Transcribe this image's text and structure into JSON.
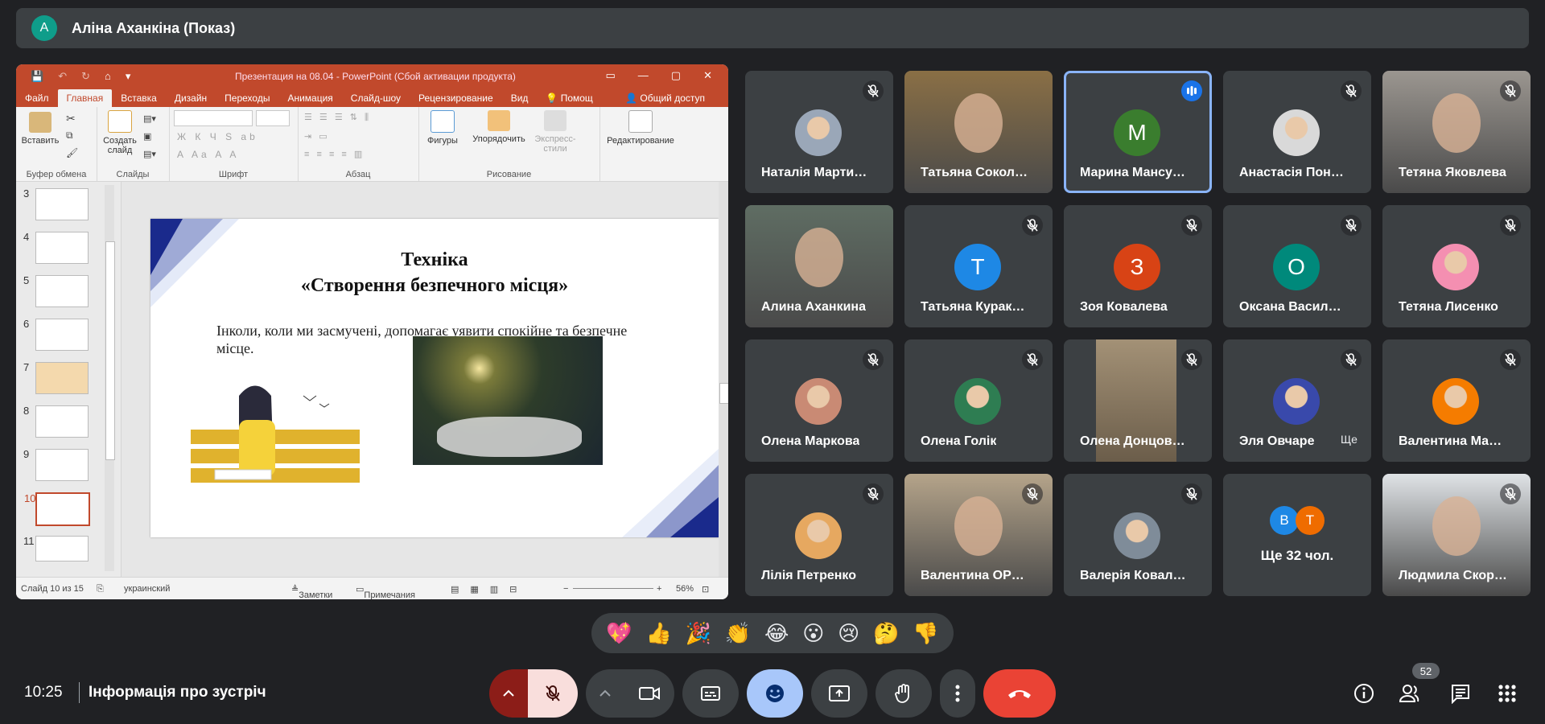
{
  "presenter": {
    "avatar_letter": "A",
    "label": "Аліна Аханкіна (Показ)"
  },
  "ppt": {
    "window_title": "Презентация на 08.04 - PowerPoint (Сбой активации продукта)",
    "menu": [
      "Файл",
      "Главная",
      "Вставка",
      "Дизайн",
      "Переходы",
      "Анимация",
      "Слайд-шоу",
      "Рецензирование",
      "Вид",
      "Помощ"
    ],
    "share": "Общий доступ",
    "ribbon": {
      "paste": "Вставить",
      "new_slide": "Создать слайд",
      "group_clipboard": "Буфер обмена",
      "group_slides": "Слайды",
      "group_font": "Шрифт",
      "group_paragraph": "Абзац",
      "group_drawing": "Рисование",
      "shapes": "Фигуры",
      "arrange": "Упорядочить",
      "express_styles": "Экспресс-стили",
      "editing": "Редактирование"
    },
    "thumb_numbers": [
      "3",
      "4",
      "5",
      "6",
      "7",
      "8",
      "9",
      "10",
      "11"
    ],
    "slide": {
      "title_line1": "Техніка",
      "title_line2": "«Створення безпечного місця»",
      "body": "Інколи, коли ми засмучені, допомагає уявити спокійне та безпечне місце."
    },
    "status": {
      "slide_of": "Слайд 10 из 15",
      "lang": "украинский",
      "notes": "Заметки",
      "comments": "Примечания",
      "zoom": "56%"
    }
  },
  "participants": [
    {
      "name": "Наталія Марти…",
      "muted": true,
      "kind": "small-photo",
      "color": "#9aa7b8"
    },
    {
      "name": "Татьяна Сокол…",
      "muted": false,
      "kind": "video",
      "color": "#8a6f45"
    },
    {
      "name": "Марина Мансу…",
      "muted": false,
      "kind": "letter",
      "letter": "M",
      "color": "#3a7d2e",
      "speaking": true
    },
    {
      "name": "Анастасія Пон…",
      "muted": true,
      "kind": "small-photo",
      "color": "#d9d9d9"
    },
    {
      "name": "Тетяна Яковлева",
      "muted": true,
      "kind": "video",
      "color": "#9b9690"
    },
    {
      "name": "Алина Аханкина",
      "muted": false,
      "kind": "video",
      "color": "#5f6d63"
    },
    {
      "name": "Татьяна Курак…",
      "muted": true,
      "kind": "letter",
      "letter": "T",
      "color": "#1e88e5"
    },
    {
      "name": "Зоя Ковалева",
      "muted": true,
      "kind": "letter",
      "letter": "З",
      "color": "#d84315"
    },
    {
      "name": "Оксана Васил…",
      "muted": true,
      "kind": "letter",
      "letter": "O",
      "color": "#00897b"
    },
    {
      "name": "Тетяна Лисенко",
      "muted": true,
      "kind": "small-photo",
      "color": "#f48fb1"
    },
    {
      "name": "Олена Маркова",
      "muted": true,
      "kind": "small-photo",
      "color": "#c98a74"
    },
    {
      "name": "Олена Голік",
      "muted": true,
      "kind": "small-photo",
      "color": "#2e7d52"
    },
    {
      "name": "Олена Донцов…",
      "muted": true,
      "kind": "video-narrow",
      "color": "#a39176"
    },
    {
      "name": "Эля Овчаре",
      "extra": "Ще",
      "muted": true,
      "kind": "small-photo",
      "color": "#3949ab"
    },
    {
      "name": "Валентина Ма…",
      "muted": true,
      "kind": "small-photo",
      "color": "#f57c00"
    },
    {
      "name": "Лілія Петренко",
      "muted": true,
      "kind": "small-photo",
      "color": "#e6a860"
    },
    {
      "name": "Валентина ОР…",
      "muted": true,
      "kind": "video",
      "color": "#b5a48a"
    },
    {
      "name": "Валерія Ковал…",
      "muted": true,
      "kind": "small-photo",
      "color": "#7f8c99"
    },
    {
      "name": "Ще 32 чол.",
      "muted": false,
      "kind": "more",
      "color": "#3c4043"
    },
    {
      "name": "Людмила Скор…",
      "muted": true,
      "kind": "video",
      "color": "#dfe3e6"
    }
  ],
  "more_tile": {
    "a": "B",
    "b": "T",
    "a_color": "#1e88e5",
    "b_color": "#ef6c00"
  },
  "reactions": [
    "💖",
    "👍",
    "🎉",
    "👏",
    "😂",
    "😮",
    "😢",
    "🤔",
    "👎"
  ],
  "bottom": {
    "time": "10:25",
    "meeting_info": "Інформація про зустріч",
    "people_count": "52"
  },
  "colors": {
    "bg": "#202124",
    "tile": "#3c4043",
    "end": "#ea4335",
    "reaction_on": "#8ab4f8"
  }
}
